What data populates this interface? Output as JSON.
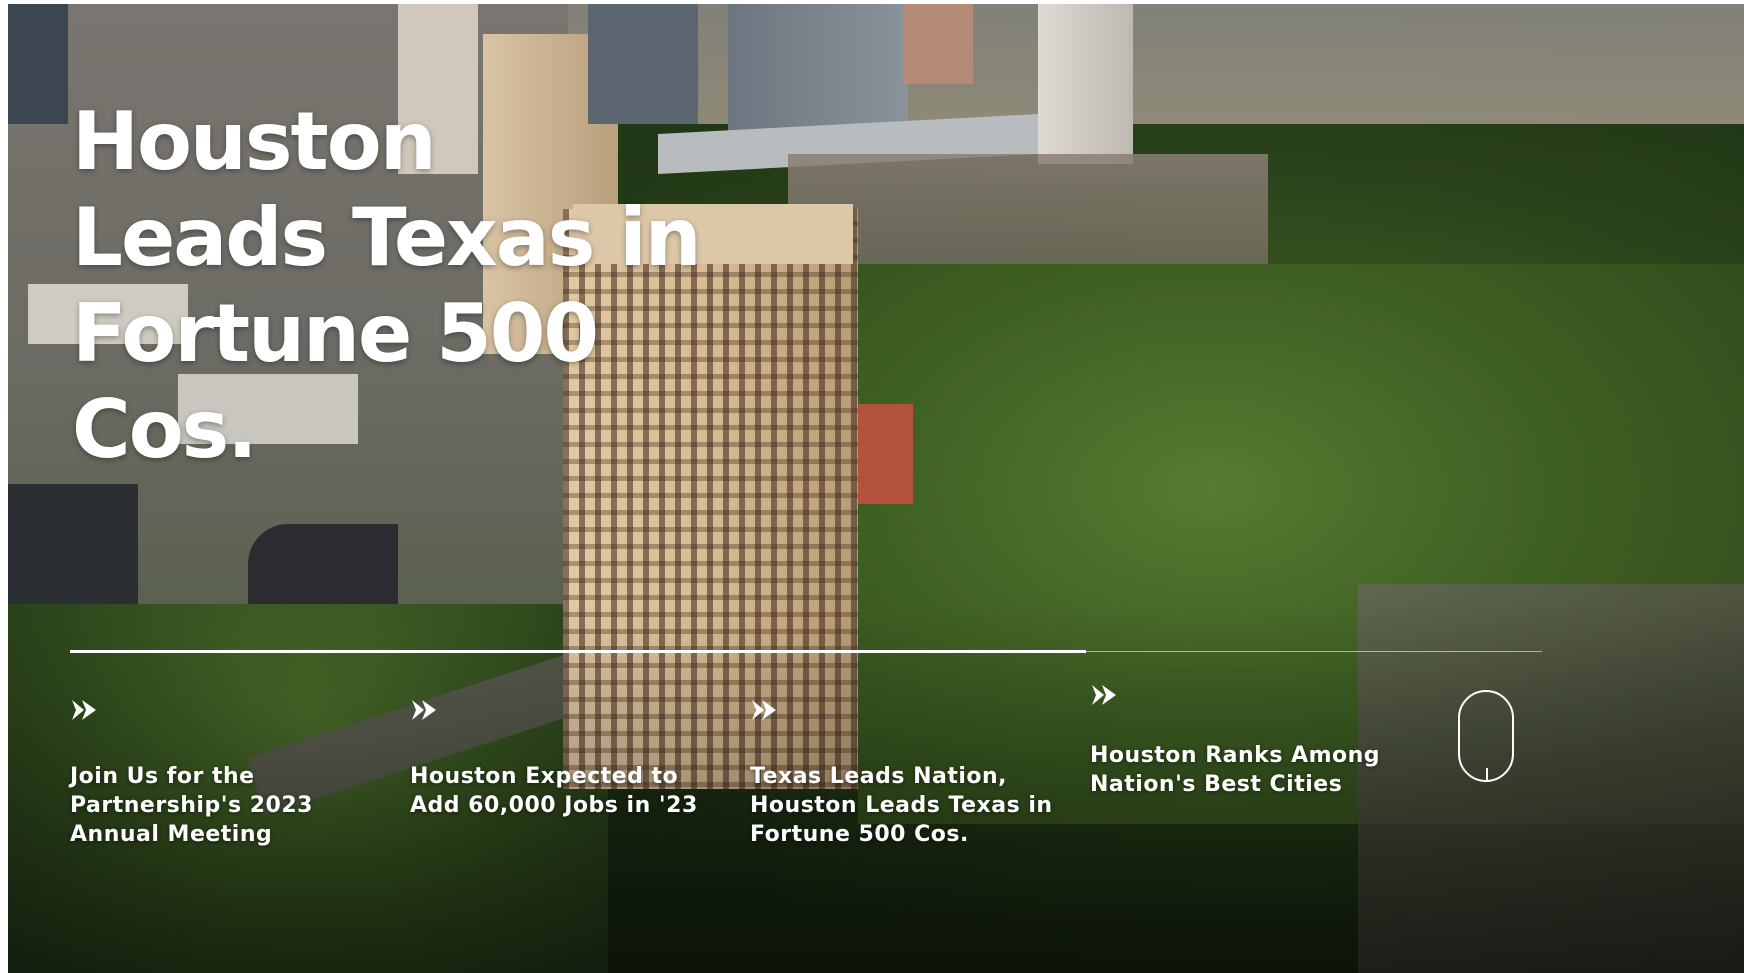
{
  "hero": {
    "headline": "Houston Leads Texas in Fortune 500 Cos.",
    "slide_progress": 0.69
  },
  "slides": [
    {
      "label": "Join Us for the Partnership's 2023 Annual Meeting",
      "icon": "double-chevron-right-icon"
    },
    {
      "label": "Houston Expected to Add 60,000 Jobs in '23",
      "icon": "double-chevron-right-icon"
    },
    {
      "label": "Texas Leads Nation, Houston Leads Texas in Fortune 500 Cos.",
      "icon": "double-chevron-right-icon"
    },
    {
      "label": "Houston Ranks Among Nation's Best Cities",
      "icon": "double-chevron-right-icon"
    }
  ],
  "scroll_indicator": {
    "icon": "mouse-scroll-icon"
  },
  "colors": {
    "text": "#ffffff",
    "accent": "#ffffff"
  }
}
